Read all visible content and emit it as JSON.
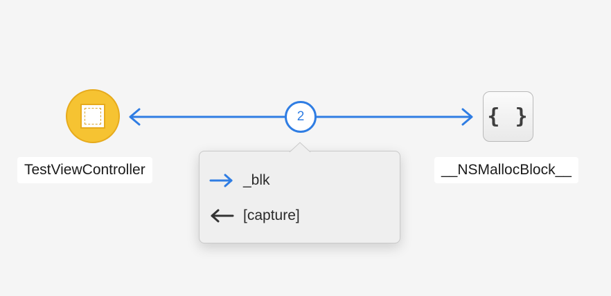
{
  "graph": {
    "source_node": {
      "name": "TestViewController",
      "icon": "view-controller-icon",
      "color": "#f6c332"
    },
    "target_node": {
      "name": "__NSMallocBlock__",
      "icon": "block-braces-icon",
      "glyph": "{ }"
    },
    "edge": {
      "reference_count": "2",
      "color": "#2f7de3"
    }
  },
  "popover": {
    "references": [
      {
        "label": "_blk",
        "direction": "outgoing",
        "icon": "arrow-right-icon",
        "color": "#2f7de3"
      },
      {
        "label": "[capture]",
        "direction": "incoming",
        "icon": "arrow-left-icon",
        "color": "#333333"
      }
    ]
  }
}
